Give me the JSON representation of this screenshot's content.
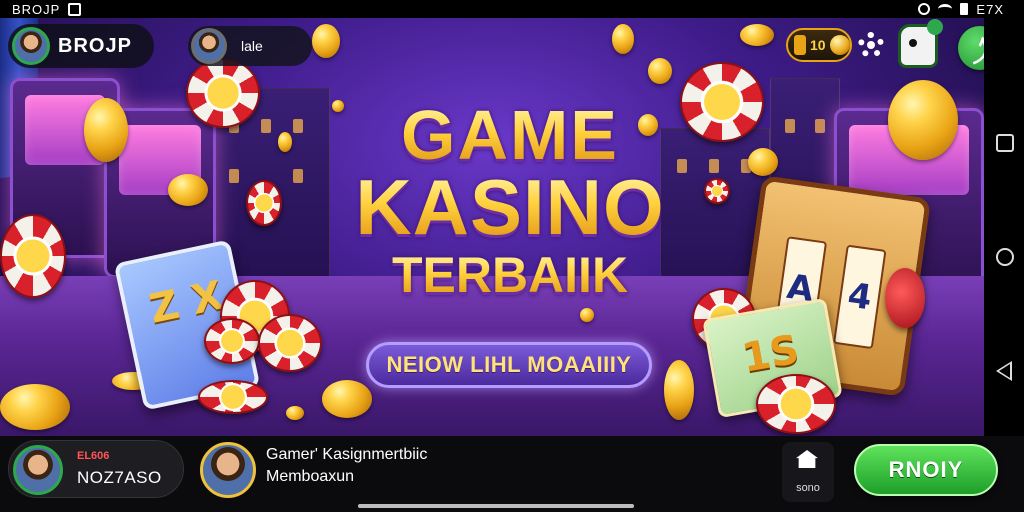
{
  "status_bar": {
    "left_text": "BROJP",
    "right_text": "E7X"
  },
  "hud": {
    "brand_label": "BROJP",
    "user_label": "lale",
    "coin_value": "10",
    "icons": [
      "gear-icon",
      "mascot-icon",
      "green-action-icon"
    ]
  },
  "title": {
    "line1": "GAME",
    "line2": "KASINO",
    "line3": "TERBAIIK"
  },
  "promo_button": "NEIOW LIHL MOAAIIIY",
  "scene_labels": {
    "card_left": "Z X",
    "slot_reels": [
      "A",
      "4"
    ],
    "ticket": "1S"
  },
  "bottom_bar": {
    "player_tag": "EL606",
    "player_code": "NOZ7ASO",
    "title": "Gamer' Kasignmertbiic",
    "subtitle": "Memboaxun",
    "home_label": "sono",
    "play_button": "RNOIY"
  },
  "colors": {
    "accent_gold": "#ffd23e",
    "play_green": "#1e9e2a",
    "scene_purple": "#3f1c8a"
  }
}
